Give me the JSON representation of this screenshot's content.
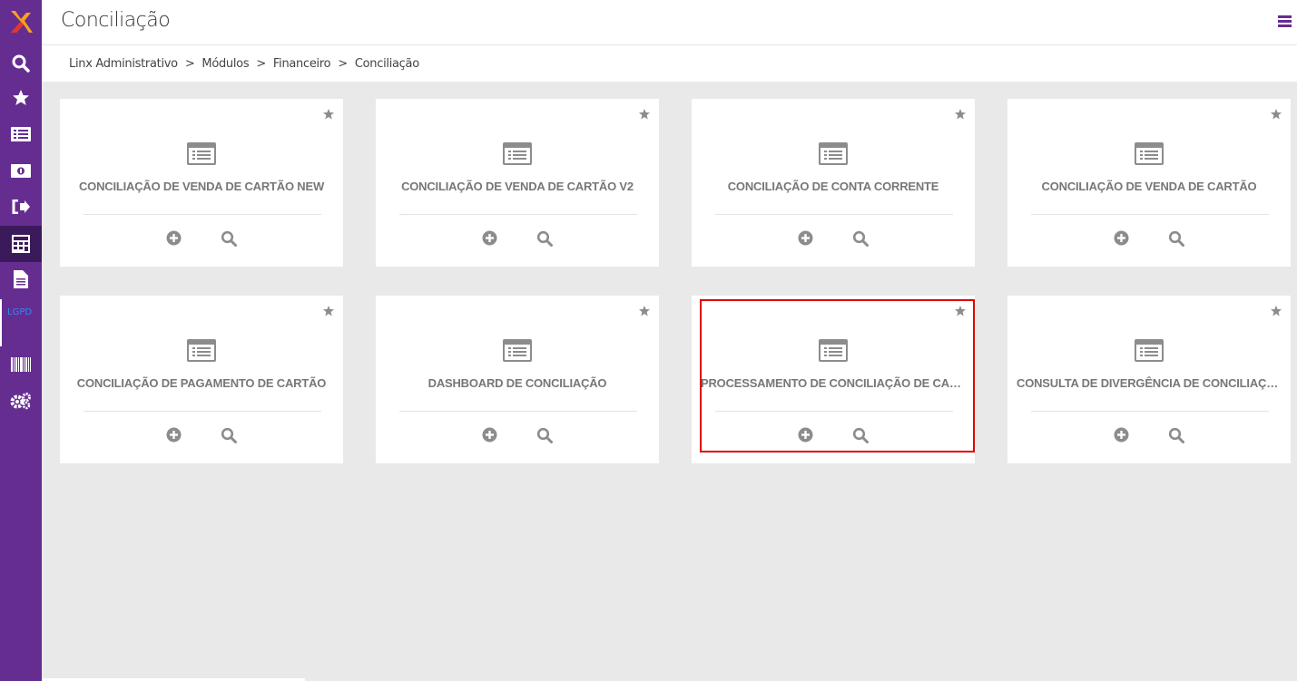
{
  "header": {
    "title": "Conciliação"
  },
  "breadcrumb": [
    "Linx Administrativo",
    "Módulos",
    "Financeiro",
    "Conciliação"
  ],
  "sidebar": {
    "items": [
      {
        "icon": "search-icon"
      },
      {
        "icon": "star-icon"
      },
      {
        "icon": "list-icon"
      },
      {
        "icon": "money-icon"
      },
      {
        "icon": "sign-out-icon"
      },
      {
        "icon": "calculator-icon"
      },
      {
        "icon": "document-icon"
      },
      {
        "icon": "barcode-icon"
      },
      {
        "icon": "gears-icon"
      }
    ],
    "partial_label": "LGPD"
  },
  "cards": [
    {
      "title": "CONCILIAÇÃO DE VENDA DE CARTÃO NEW"
    },
    {
      "title": "CONCILIAÇÃO DE VENDA DE CARTÃO V2"
    },
    {
      "title": "CONCILIAÇÃO DE CONTA CORRENTE"
    },
    {
      "title": "CONCILIAÇÃO DE VENDA DE CARTÃO"
    },
    {
      "title": "CONCILIAÇÃO DE PAGAMENTO DE CARTÃO"
    },
    {
      "title": "DASHBOARD DE CONCILIAÇÃO"
    },
    {
      "title": "PROCESSAMENTO DE CONCILIAÇÃO DE CART..."
    },
    {
      "title": "CONSULTA DE DIVERGÊNCIA DE CONCILIAÇÃO"
    }
  ],
  "colors": {
    "sidebar": "#662d91",
    "highlight": "#e00000",
    "icon_gray": "#8c8c8c"
  }
}
